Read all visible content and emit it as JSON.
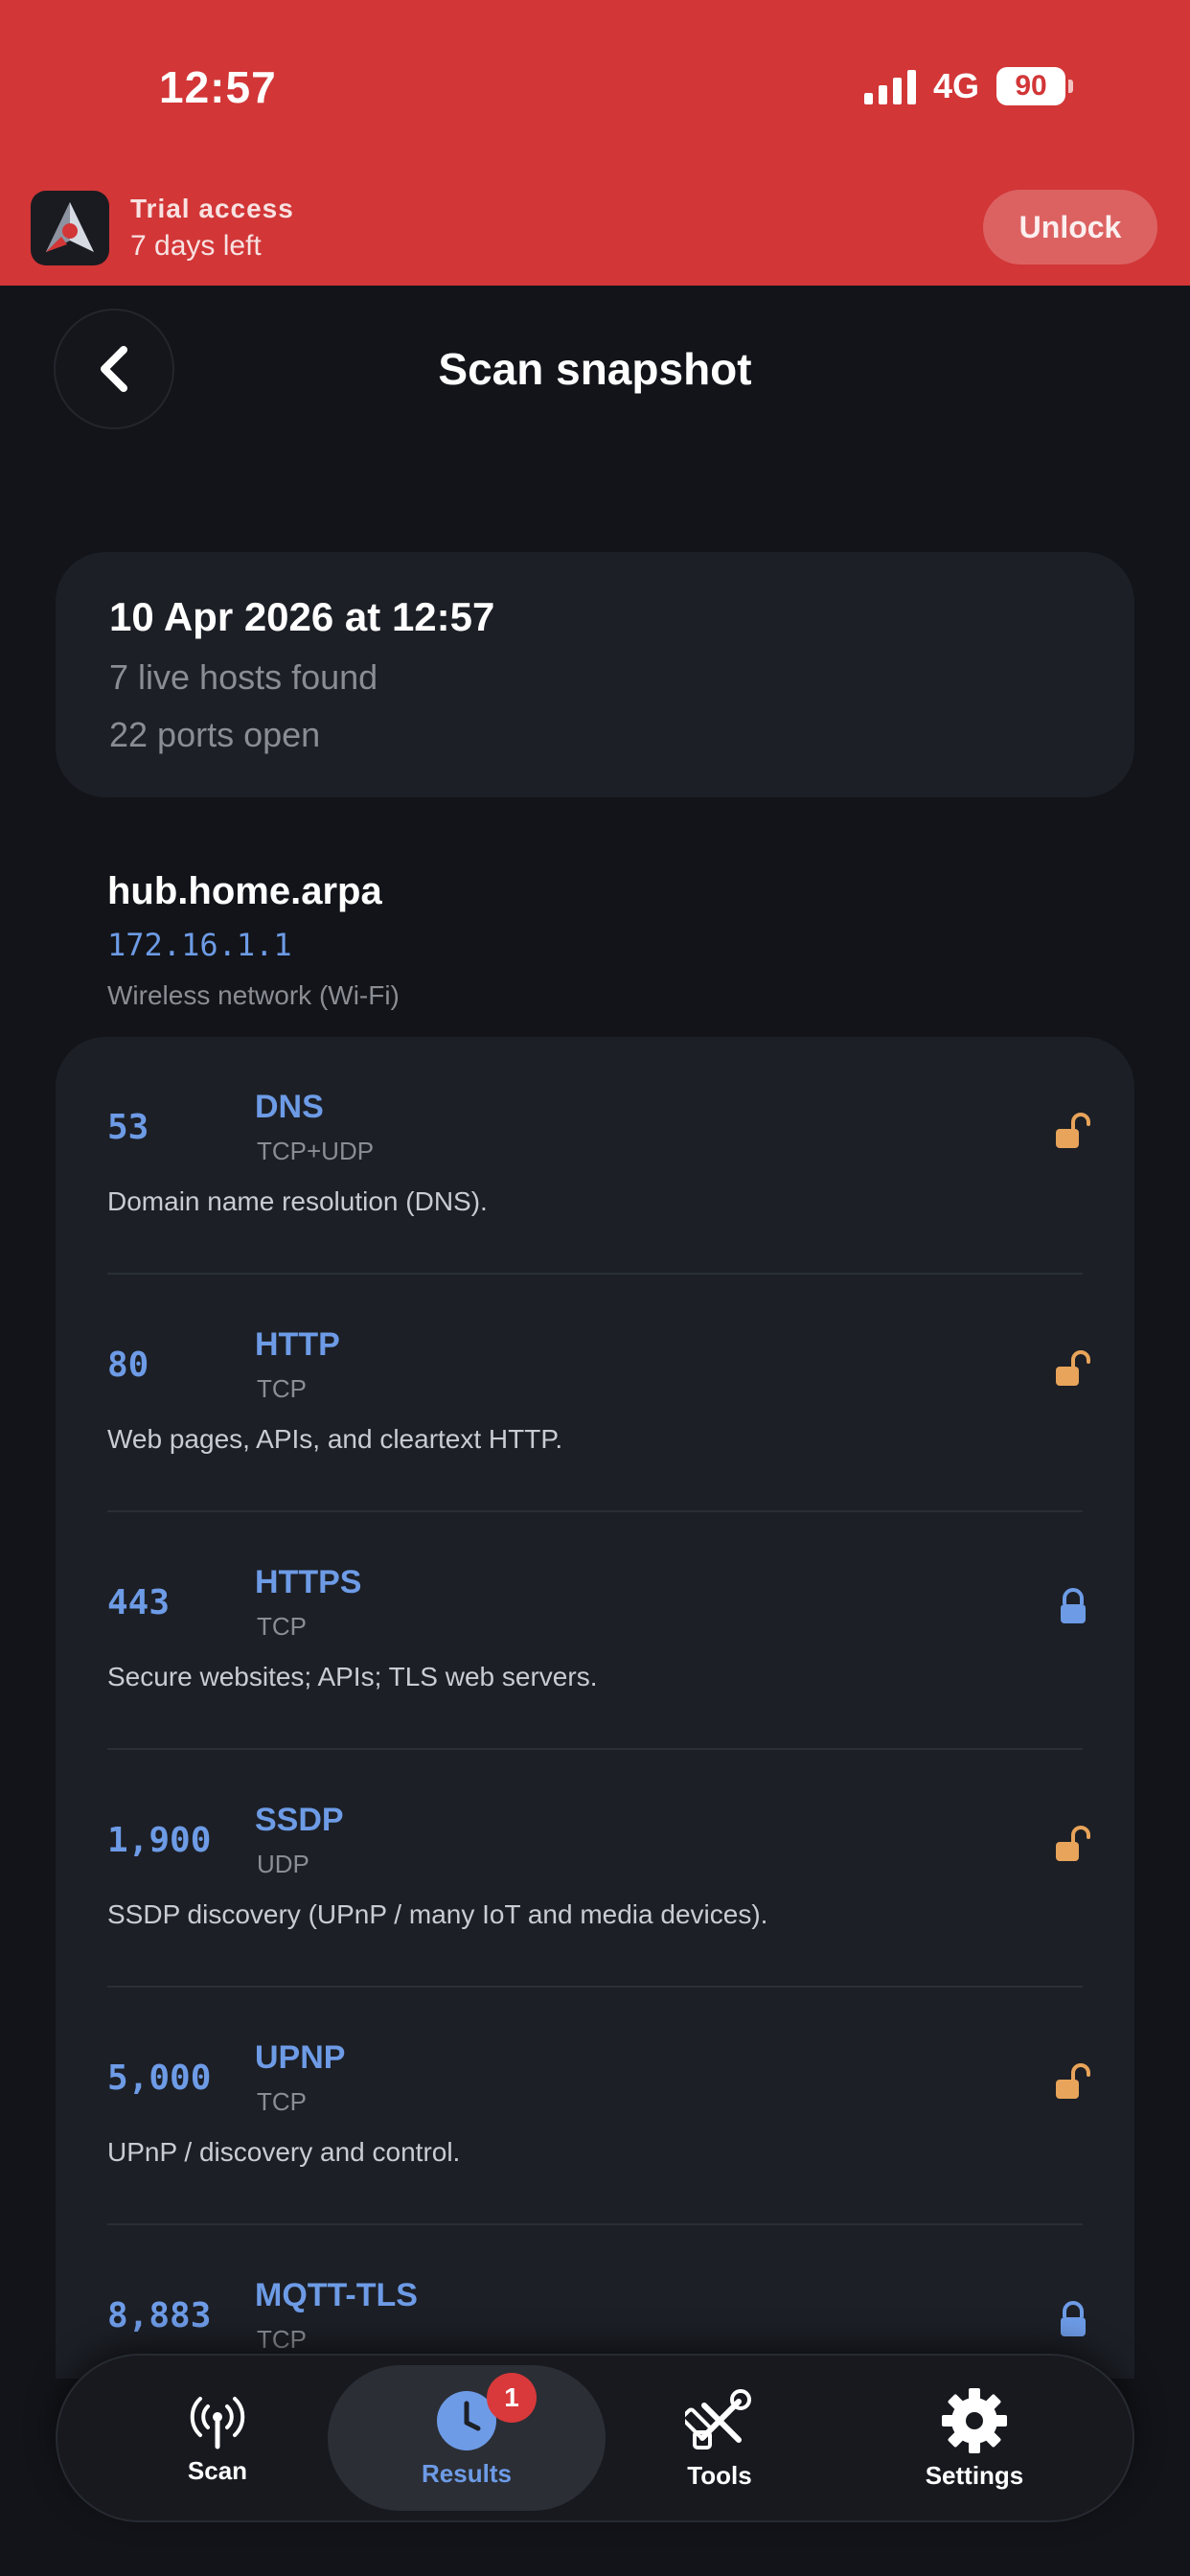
{
  "status": {
    "time": "12:57",
    "network": "4G",
    "battery": "90"
  },
  "trial": {
    "title": "Trial access",
    "subtitle": "7 days left",
    "unlock_label": "Unlock"
  },
  "nav": {
    "title": "Scan snapshot"
  },
  "summary": {
    "date": "10 Apr 2026 at 12:57",
    "hosts": "7 live hosts found",
    "ports": "22 ports open"
  },
  "host": {
    "name": "hub.home.arpa",
    "ip": "172.16.1.1",
    "network": "Wireless network (Wi-Fi)"
  },
  "ports": [
    {
      "number": "53",
      "service": "DNS",
      "protocol": "TCP+UDP",
      "description": "Domain name resolution (DNS).",
      "lock": "unlocked"
    },
    {
      "number": "80",
      "service": "HTTP",
      "protocol": "TCP",
      "description": "Web pages, APIs, and cleartext HTTP.",
      "lock": "unlocked"
    },
    {
      "number": "443",
      "service": "HTTPS",
      "protocol": "TCP",
      "description": "Secure websites; APIs; TLS web servers.",
      "lock": "locked"
    },
    {
      "number": "1,900",
      "service": "SSDP",
      "protocol": "UDP",
      "description": "SSDP discovery (UPnP / many IoT and media devices).",
      "lock": "unlocked"
    },
    {
      "number": "5,000",
      "service": "UPNP",
      "protocol": "TCP",
      "description": "UPnP / discovery and control.",
      "lock": "unlocked"
    },
    {
      "number": "8,883",
      "service": "MQTT-TLS",
      "protocol": "TCP",
      "description": "",
      "lock": "locked"
    }
  ],
  "tabs": [
    {
      "label": "Scan",
      "icon": "antenna-icon"
    },
    {
      "label": "Results",
      "icon": "clock-icon",
      "badge": "1",
      "active": true
    },
    {
      "label": "Tools",
      "icon": "tools-icon"
    },
    {
      "label": "Settings",
      "icon": "gear-icon"
    }
  ],
  "colors": {
    "header": "#d23637",
    "background": "#121419",
    "card": "#1c1f26",
    "accent": "#6d9be6",
    "unlocked": "#e8a45a",
    "locked": "#6d9be6"
  }
}
